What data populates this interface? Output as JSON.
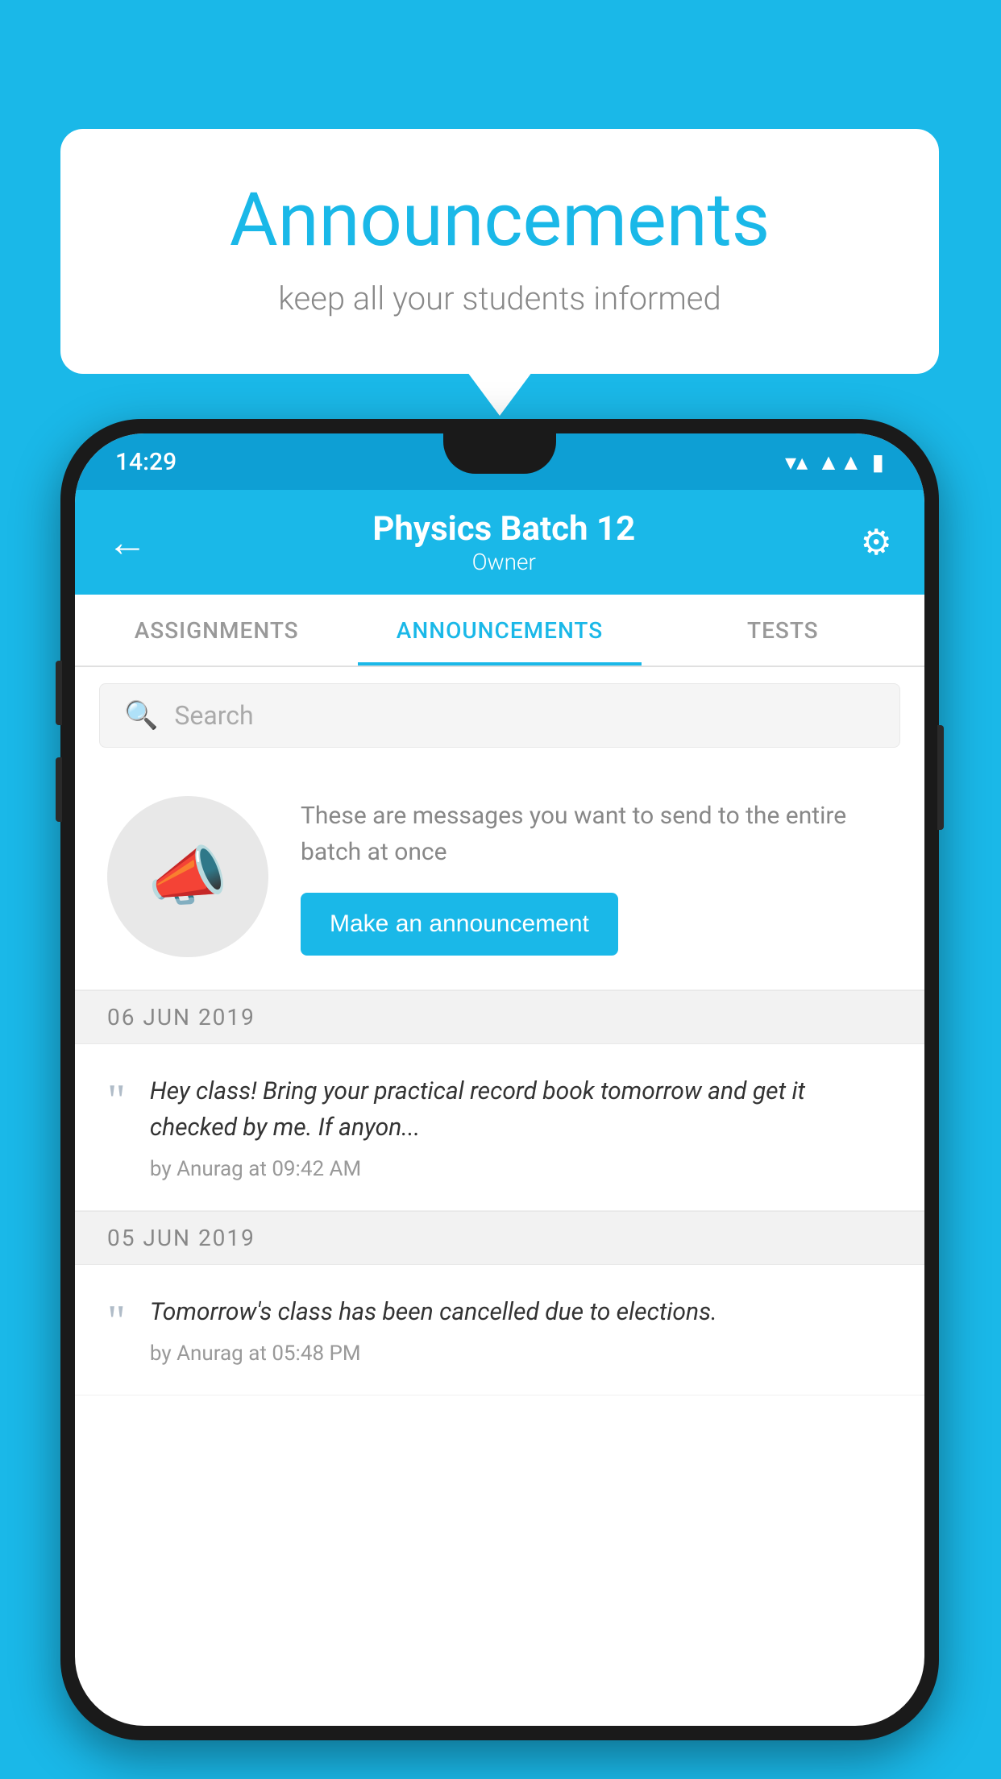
{
  "background_color": "#1ab8e8",
  "speech_bubble": {
    "title": "Announcements",
    "subtitle": "keep all your students informed"
  },
  "phone": {
    "status_bar": {
      "time": "14:29",
      "icons": [
        "wifi",
        "signal",
        "battery"
      ]
    },
    "app_bar": {
      "title": "Physics Batch 12",
      "subtitle": "Owner",
      "back_label": "←",
      "settings_label": "⚙"
    },
    "tabs": [
      {
        "label": "ASSIGNMENTS",
        "active": false
      },
      {
        "label": "ANNOUNCEMENTS",
        "active": true
      },
      {
        "label": "TESTS",
        "active": false
      },
      {
        "label": "...",
        "active": false
      }
    ],
    "search": {
      "placeholder": "Search"
    },
    "promo": {
      "description": "These are messages you want to send to the entire batch at once",
      "button_label": "Make an announcement"
    },
    "announcements": [
      {
        "date": "06  JUN  2019",
        "text": "Hey class! Bring your practical record book tomorrow and get it checked by me. If anyon...",
        "author": "by Anurag at 09:42 AM"
      },
      {
        "date": "05  JUN  2019",
        "text": "Tomorrow's class has been cancelled due to elections.",
        "author": "by Anurag at 05:48 PM"
      }
    ]
  }
}
